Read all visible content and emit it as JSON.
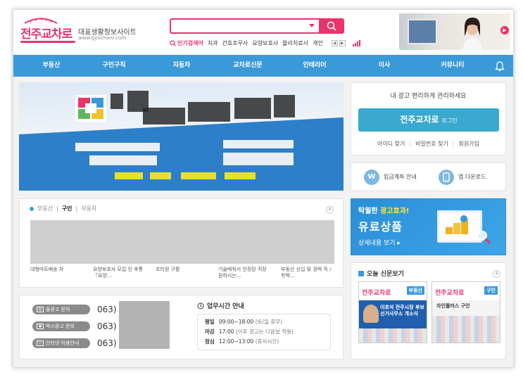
{
  "header": {
    "logo_main": "전주교차로",
    "logo_sub": "대표생활정보사이트",
    "logo_url": "www.gyocharo.com",
    "search_placeholder": "",
    "popular_label": "인기검색어",
    "popular_terms": [
      "치과",
      "간호조무사",
      "요양보호사",
      "물리치료사",
      "개인"
    ],
    "arrow_prev": "◀",
    "arrow_next": "▶",
    "ad_dot": "▶"
  },
  "nav": {
    "items": [
      "부동산",
      "구인구직",
      "자동차",
      "교차로신문",
      "인테리어",
      "이사",
      "커뮤니티"
    ]
  },
  "login": {
    "title": "내 광고 편리하게 관리하세요",
    "button_main": "전주교차로",
    "button_sub": "로그인",
    "find_id": "아이디 찾기",
    "find_pw": "비밀번호 찾기",
    "join": "회원가입",
    "sep": "|"
  },
  "quick": {
    "deposit_icon": "W",
    "deposit_label": "입금계좌 안내",
    "app_label": "앱 다운로드"
  },
  "paid": {
    "line1_a": "탁월한 ",
    "line1_b": "광고효과!",
    "line2": "유료상품",
    "line3": "상세내용 보기 ▸"
  },
  "listings": {
    "tab1": "부동산",
    "tab2": "구인",
    "tab3": "자동차",
    "sep": "|",
    "plus": "+",
    "items": [
      "대형마트배송 차",
      "요양보호사 모집 인 후통 「요양...",
      "조리원 구함",
      "기술배워서 안정된 직장 원하시는...",
      "부동산 신입 및 경력 직 /학력..."
    ]
  },
  "contact": {
    "rows": [
      {
        "label": "줄광고 문의",
        "number": "063)"
      },
      {
        "label": "박스광고 문의",
        "number": "063)"
      },
      {
        "label": "인터넷 이용안내",
        "number": "063)"
      }
    ],
    "hours_title": "업무시간 안내",
    "hours": [
      {
        "k": "평일",
        "v": "09:00~18:00",
        "n": "(토/일 휴무)"
      },
      {
        "k": "마감",
        "v": "17:00",
        "n": "(이후 광고는 다음날 적용)"
      },
      {
        "k": "점심",
        "v": "12:00~13:00",
        "n": "(휴식시간)"
      }
    ]
  },
  "newspaper": {
    "title": "오늘 신문보기",
    "plus": "+",
    "papers": [
      {
        "logo": "전주교차로",
        "tag": "부동산",
        "text": "이호석 전주시장 후보 선거사무소 개소식"
      },
      {
        "logo": "전주교차로",
        "tag": "구인",
        "text": "자인플러스 구인"
      }
    ]
  },
  "colors": {
    "brand_pink": "#e8336b",
    "nav_blue": "#3a9ad9",
    "login_teal": "#39a9cf"
  }
}
